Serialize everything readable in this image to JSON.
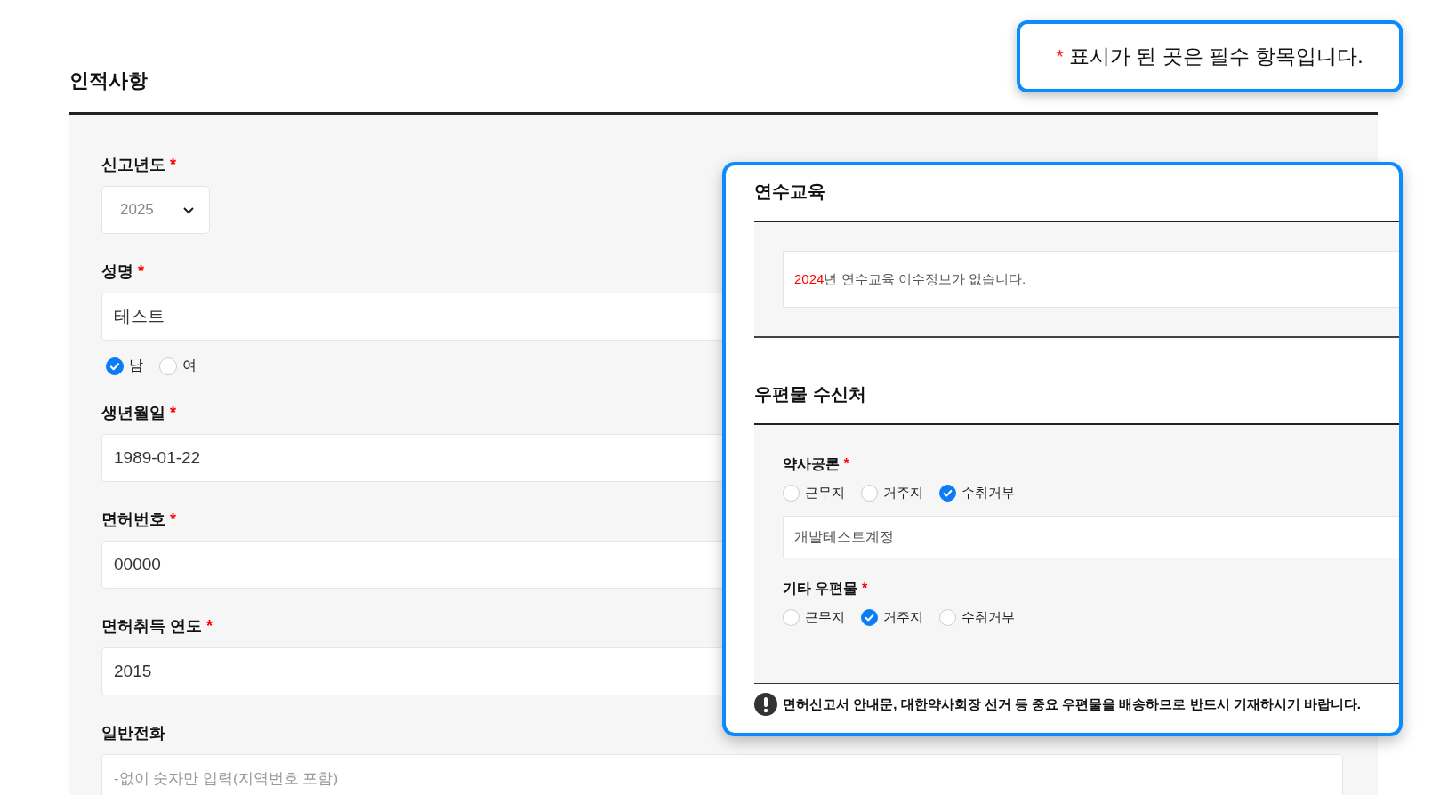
{
  "notice": {
    "mark": "*",
    "text": "표시가 된 곳은 필수 항목입니다."
  },
  "section": {
    "title": "인적사항"
  },
  "fields": [
    {
      "kind": "select",
      "label": "신고년도",
      "required_mark": "*",
      "value": "2025"
    },
    {
      "kind": "text",
      "label": "성명",
      "required_mark": "*",
      "value": "테스트",
      "options": [
        {
          "label": "남",
          "selected": true
        },
        {
          "label": "여",
          "selected": false
        }
      ]
    },
    {
      "kind": "text",
      "label": "생년월일",
      "required_mark": "*",
      "value": "1989-01-22"
    },
    {
      "kind": "text",
      "label": "면허번호",
      "required_mark": "*",
      "value": "00000"
    },
    {
      "kind": "text",
      "label": "면허취득 연도",
      "required_mark": "*",
      "value": "2015"
    },
    {
      "kind": "text",
      "label": "일반전화",
      "placeholder": "-없이 숫자만 입력(지역번호 포함)"
    }
  ],
  "popup": {
    "education": {
      "title": "연수교육",
      "year": "2024",
      "message": "년 연수교육 이수정보가 없습니다."
    },
    "mail": {
      "title": "우편물 수신처",
      "groups": [
        {
          "label": "약사공론",
          "required_mark": "*",
          "options": [
            {
              "label": "근무지",
              "selected": false
            },
            {
              "label": "거주지",
              "selected": false
            },
            {
              "label": "수취거부",
              "selected": true
            }
          ],
          "value": "개발테스트계정"
        },
        {
          "label": "기타 우편물",
          "required_mark": "*",
          "options": [
            {
              "label": "근무지",
              "selected": false
            },
            {
              "label": "거주지",
              "selected": true
            },
            {
              "label": "수취거부",
              "selected": false
            }
          ]
        }
      ]
    },
    "warning": "면허신고서 안내문, 대한약사회장 선거 등 중요 우편물을 배송하므로 반드시 기재하시기 바랍니다."
  }
}
